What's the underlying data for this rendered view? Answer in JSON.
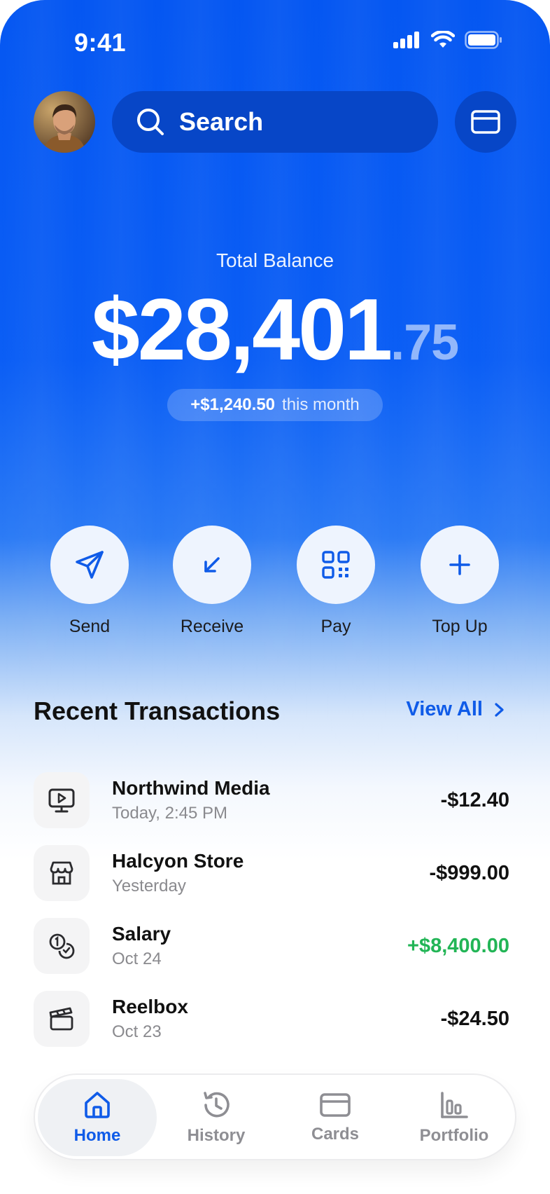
{
  "status_bar": {
    "time": "9:41"
  },
  "header": {
    "search_placeholder": "Search",
    "avatar_icon": "user-avatar",
    "card_icon": "credit-card-icon"
  },
  "balance": {
    "label": "Total Balance",
    "amount_main": "$28,401",
    "amount_cents": ".75",
    "change_value": "+$1,240.50",
    "change_period": "this month"
  },
  "actions": [
    {
      "label": "Send",
      "icon": "send-icon"
    },
    {
      "label": "Receive",
      "icon": "receive-icon"
    },
    {
      "label": "Pay",
      "icon": "qr-code-icon"
    },
    {
      "label": "Top Up",
      "icon": "plus-icon"
    }
  ],
  "transactions": {
    "title": "Recent Transactions",
    "view_all": "View All",
    "items": [
      {
        "name": "Northwind Media",
        "date": "Today, 2:45 PM",
        "amount": "-$12.40",
        "icon": "monitor-play-icon"
      },
      {
        "name": "Halcyon Store",
        "date": "Yesterday",
        "amount": "-$999.00",
        "icon": "store-icon"
      },
      {
        "name": "Salary",
        "date": "Oct 24",
        "amount": "+$8,400.00",
        "icon": "coins-icon"
      },
      {
        "name": "Reelbox",
        "date": "Oct 23",
        "amount": "-$24.50",
        "icon": "clapperboard-icon"
      }
    ]
  },
  "tabbar": {
    "tabs": [
      {
        "label": "Home",
        "icon": "home-icon",
        "active": true
      },
      {
        "label": "History",
        "icon": "history-icon",
        "active": false
      },
      {
        "label": "Cards",
        "icon": "card-icon",
        "active": false
      },
      {
        "label": "Portfolio",
        "icon": "bar-chart-icon",
        "active": false
      }
    ]
  },
  "colors": {
    "primary": "#0557F2",
    "accent_text": "#0F5BE8",
    "positive": "#22B556"
  }
}
